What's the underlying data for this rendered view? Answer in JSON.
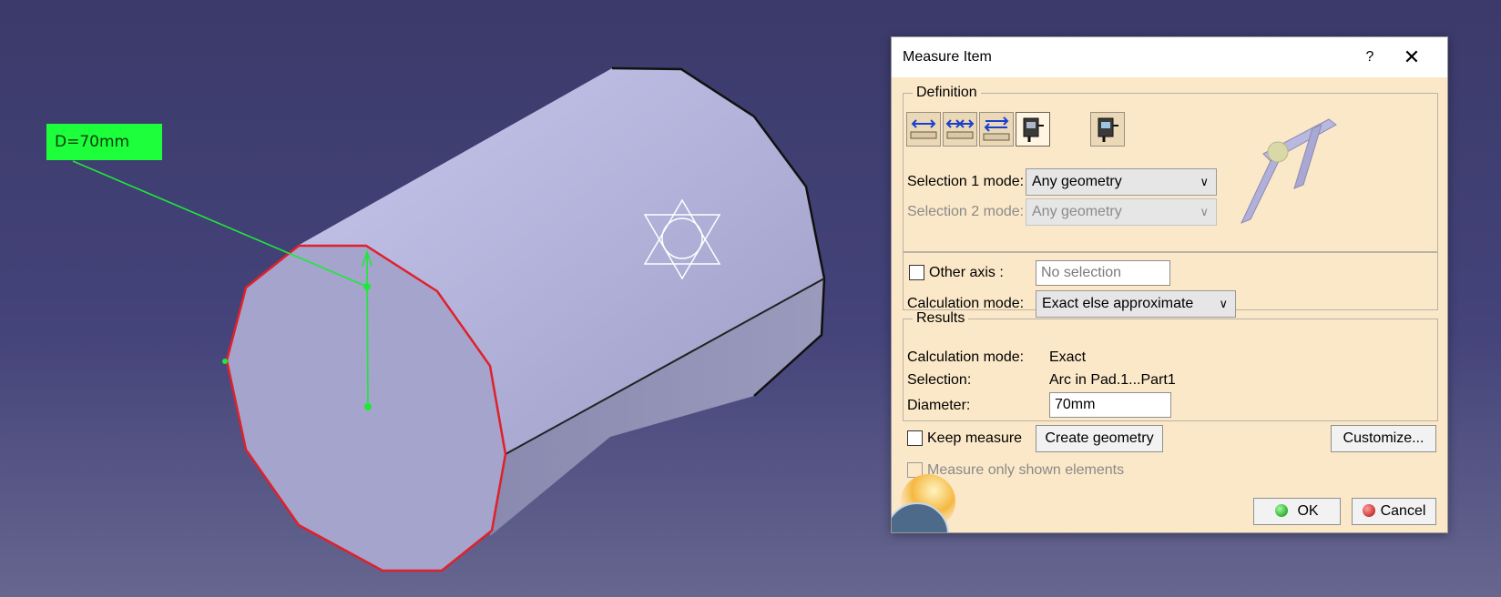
{
  "viewport": {
    "dimension_label": "D=70mm",
    "colors": {
      "background_top": "#3b3a6a",
      "label_bg": "#1dff3a",
      "highlight_edge": "#e0202a",
      "body": "#a8a8d4"
    }
  },
  "dialog": {
    "title": "Measure Item",
    "help": "?",
    "close": "✕",
    "definition": {
      "legend": "Definition",
      "tool_icons": [
        "measure-between-icon",
        "measure-between-chain-icon",
        "measure-between-fan-icon",
        "measure-item-icon",
        "measure-thickness-icon"
      ],
      "selection1_label": "Selection 1 mode:",
      "selection1_value": "Any geometry",
      "selection2_label": "Selection 2 mode:",
      "selection2_value": "Any geometry",
      "other_axis_label": "Other axis :",
      "other_axis_placeholder": "No selection",
      "calc_mode_label": "Calculation mode:",
      "calc_mode_value": "Exact else approximate"
    },
    "results": {
      "legend": "Results",
      "calc_mode_label": "Calculation mode:",
      "calc_mode_value": "Exact",
      "selection_label": "Selection:",
      "selection_value": "Arc in Pad.1...Part1",
      "diameter_label": "Diameter:",
      "diameter_value": "70mm"
    },
    "keep_measure_label": "Keep measure",
    "create_geometry_label": "Create geometry",
    "customize_label": "Customize...",
    "measure_only_shown_label": "Measure only shown elements",
    "ok_label": "OK",
    "cancel_label": "Cancel"
  }
}
